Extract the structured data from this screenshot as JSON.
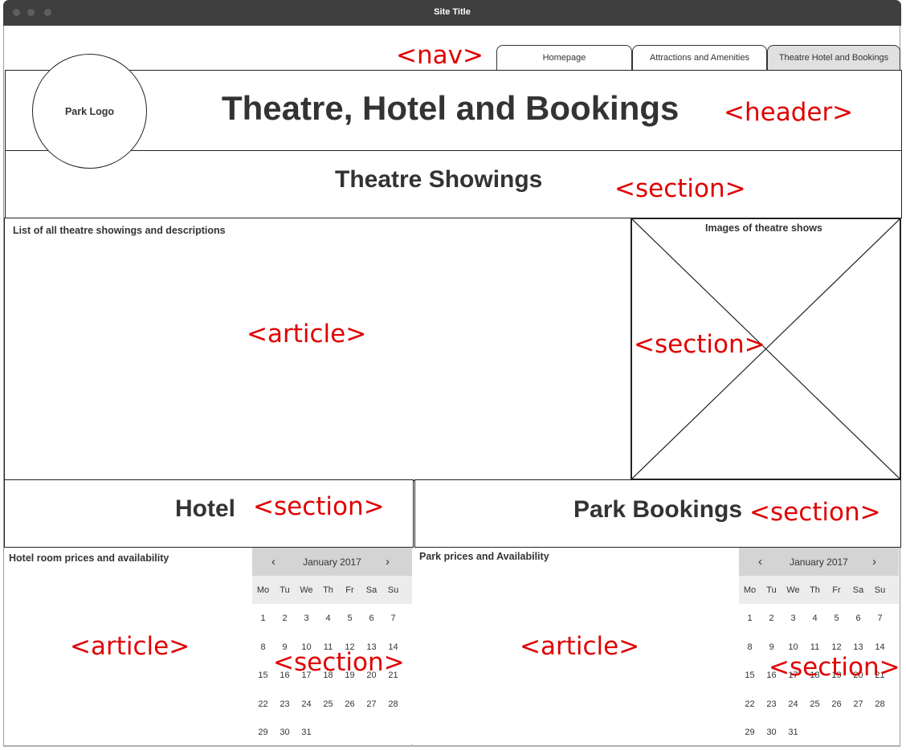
{
  "window": {
    "title": "Site Title"
  },
  "nav": {
    "tabs": [
      {
        "label": "Homepage"
      },
      {
        "label": "Attractions and Amenities"
      },
      {
        "label": "Theatre Hotel and Bookings"
      }
    ],
    "active_tab": "Theatre Hotel and Bookings"
  },
  "header": {
    "logo_text": "Park Logo",
    "title": "Theatre, Hotel and Bookings"
  },
  "theatre": {
    "title": "Theatre Showings",
    "article_text": "List of all theatre showings and descriptions",
    "images_text": "Images of theatre shows"
  },
  "hotel": {
    "title": "Hotel",
    "article_text": "Hotel room prices and availability"
  },
  "park": {
    "title": "Park Bookings",
    "article_text": "Park prices and Availability"
  },
  "annotations": {
    "nav": "<nav>",
    "header": "<header>",
    "section": "<section>",
    "article": "<article>"
  },
  "calendar": {
    "month": "January 2017",
    "prev": "‹",
    "next": "›",
    "weekdays": [
      "Mo",
      "Tu",
      "We",
      "Th",
      "Fr",
      "Sa",
      "Su"
    ],
    "weeks": [
      [
        "1",
        "2",
        "3",
        "4",
        "5",
        "6",
        "7"
      ],
      [
        "8",
        "9",
        "10",
        "11",
        "12",
        "13",
        "14"
      ],
      [
        "15",
        "16",
        "17",
        "18",
        "19",
        "20",
        "21"
      ],
      [
        "22",
        "23",
        "24",
        "25",
        "26",
        "27",
        "28"
      ],
      [
        "29",
        "30",
        "31"
      ]
    ]
  },
  "colors": {
    "annotation": "#e00000",
    "active_tab": "#e0e0e0",
    "calendar_header": "#d4d4d4"
  }
}
